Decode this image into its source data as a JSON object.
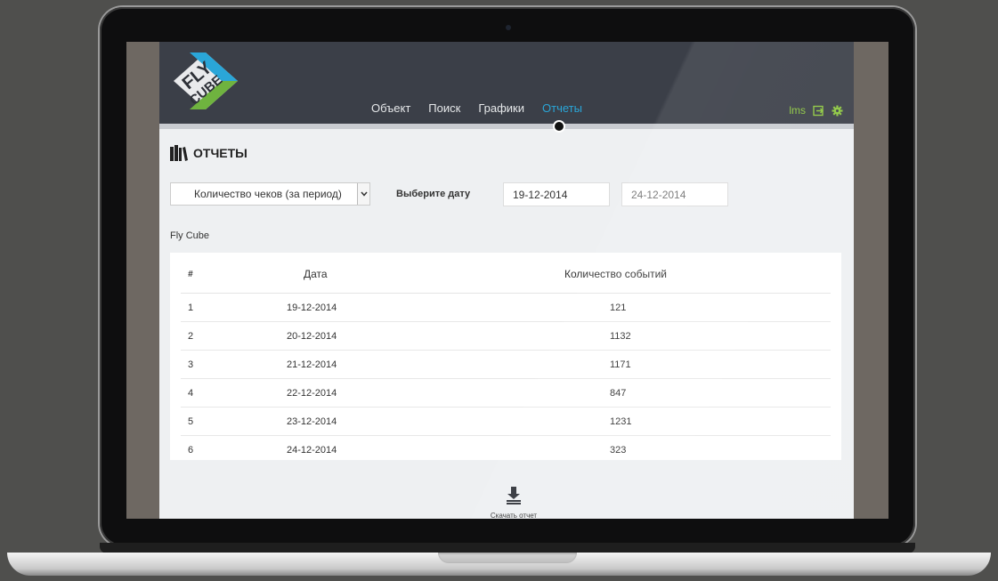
{
  "brand": {
    "logo_top": "FLY",
    "logo_bottom": "CUBE",
    "colors": {
      "blue": "#2aa6d8",
      "green": "#6fb33f",
      "nav_bg": "#3b3f48",
      "accent_user": "#8cc63f"
    }
  },
  "nav": {
    "items": [
      {
        "label": "Объект"
      },
      {
        "label": "Поиск"
      },
      {
        "label": "Графики"
      },
      {
        "label": "Отчеты",
        "active": true
      }
    ],
    "user": "lms",
    "icons": [
      "logout-icon",
      "gear-icon"
    ]
  },
  "page": {
    "title": "ОТЧЕТЫ",
    "report_select": "Количество чеков (за период)",
    "date_label": "Выберите дату",
    "date_from": "19-12-2014",
    "date_to": "24-12-2014",
    "company": "Fly Cube"
  },
  "table": {
    "headers": {
      "num": "#",
      "date": "Дата",
      "count": "Количество событий"
    },
    "rows": [
      {
        "num": "1",
        "date": "19-12-2014",
        "count": "121"
      },
      {
        "num": "2",
        "date": "20-12-2014",
        "count": "1132"
      },
      {
        "num": "3",
        "date": "21-12-2014",
        "count": "1171"
      },
      {
        "num": "4",
        "date": "22-12-2014",
        "count": "847"
      },
      {
        "num": "5",
        "date": "23-12-2014",
        "count": "1231"
      },
      {
        "num": "6",
        "date": "24-12-2014",
        "count": "323"
      }
    ]
  },
  "download": {
    "label": "Скачать отчет"
  }
}
